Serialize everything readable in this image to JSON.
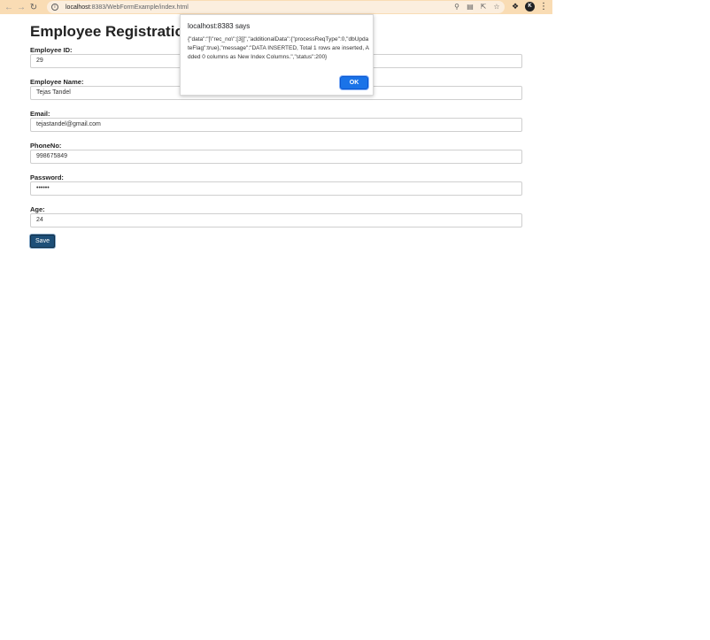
{
  "browser": {
    "back_icon": "arrow-left-icon",
    "forward_icon": "arrow-right-icon",
    "reload_icon": "reload-icon",
    "url_host": "localhost",
    "url_rest": ":8383/WebFormExample/index.html",
    "omnibox_icons": [
      "key-icon",
      "translate-icon",
      "share-icon",
      "star-icon"
    ],
    "extensions_icon": "puzzle-icon",
    "profile_initial": "K",
    "toolbar_color": "#f9dcb4"
  },
  "form": {
    "title": "Employee Registration F",
    "fields": [
      {
        "label": "Employee ID:",
        "value": "29"
      },
      {
        "label": "Employee Name:",
        "value": "Tejas Tandel"
      },
      {
        "label": "Email:",
        "value": "tejastandel@gmail.com"
      },
      {
        "label": "PhoneNo:",
        "value": "998675849"
      },
      {
        "label": "Password:",
        "value": "••••••"
      },
      {
        "label": "Age:",
        "value": "24"
      }
    ],
    "save_label": "Save",
    "save_color": "#1d4f78"
  },
  "dialog": {
    "title": "localhost:8383 says",
    "message": "{\"data\":\"[\\\"rec_no\\\":[3]]\",\"additionalData\":{\"processReqType\":0,\"dbUpdateFlag\":true},\"message\":\"DATA INSERTED, Total 1 rows are inserted, Added 0 columns as New Index Columns.\",\"status\":200}",
    "ok_label": "OK",
    "ok_color": "#1a73e8"
  }
}
